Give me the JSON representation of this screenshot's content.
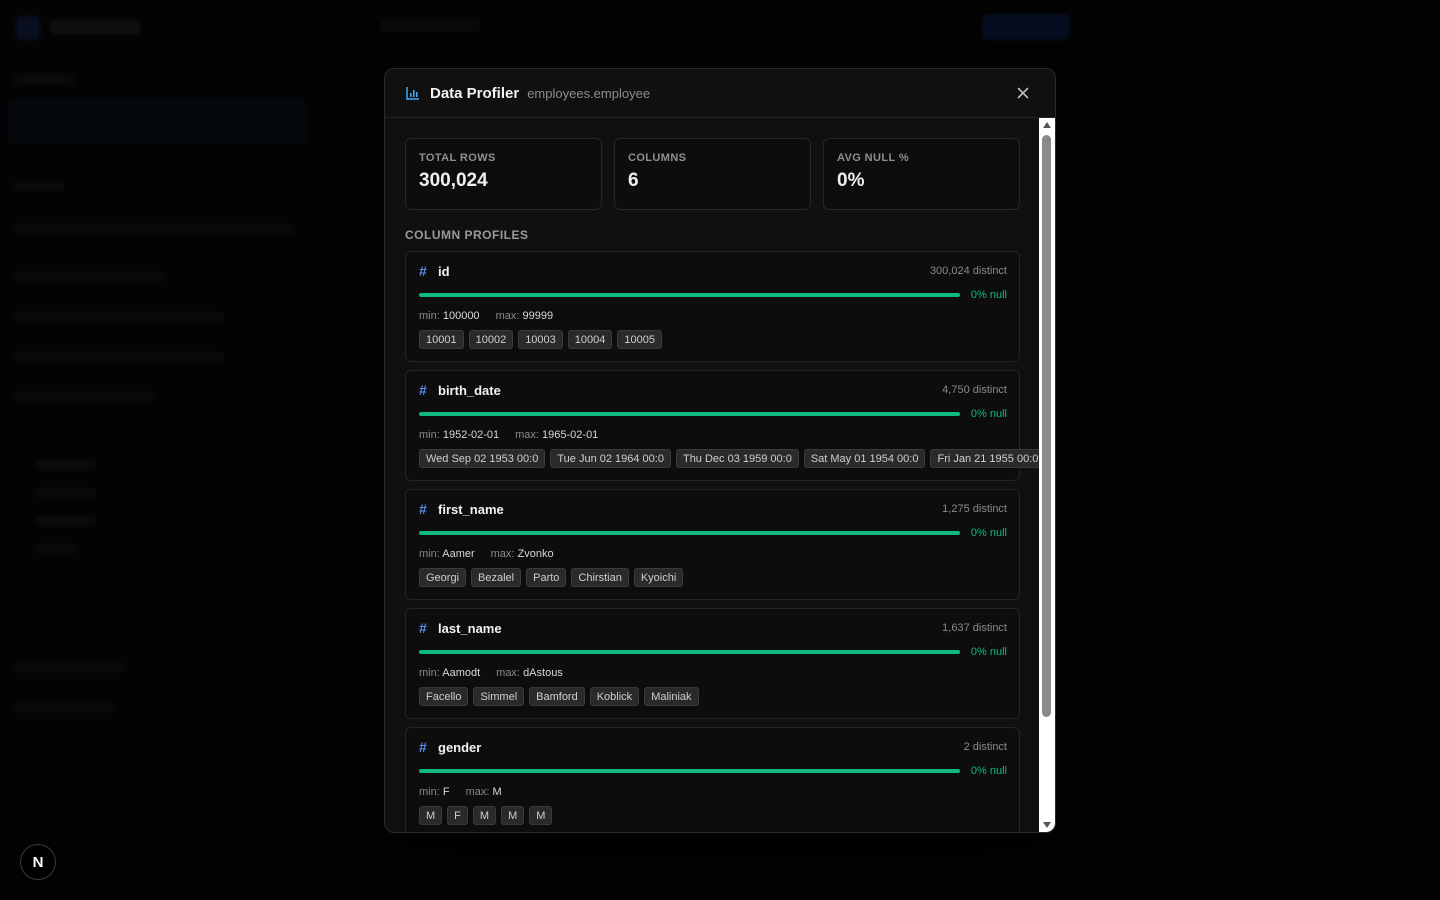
{
  "modal": {
    "title": "Data Profiler",
    "subtitle": "employees.employee"
  },
  "stats": [
    {
      "label": "TOTAL ROWS",
      "value": "300,024"
    },
    {
      "label": "COLUMNS",
      "value": "6"
    },
    {
      "label": "AVG NULL %",
      "value": "0%"
    }
  ],
  "section_title": "COLUMN PROFILES",
  "columns": [
    {
      "icon": "#",
      "name": "id",
      "distinct": "300,024 distinct",
      "null_text": "0% null",
      "min_label": "min:",
      "min": "100000",
      "max_label": "max:",
      "max": "99999",
      "samples": [
        "10001",
        "10002",
        "10003",
        "10004",
        "10005"
      ]
    },
    {
      "icon": "#",
      "name": "birth_date",
      "distinct": "4,750 distinct",
      "null_text": "0% null",
      "min_label": "min:",
      "min": "1952-02-01",
      "max_label": "max:",
      "max": "1965-02-01",
      "samples": [
        "Wed Sep 02 1953 00:0",
        "Tue Jun 02 1964 00:0",
        "Thu Dec 03 1959 00:0",
        "Sat May 01 1954 00:0",
        "Fri Jan 21 1955 00:0"
      ]
    },
    {
      "icon": "#",
      "name": "first_name",
      "distinct": "1,275 distinct",
      "null_text": "0% null",
      "min_label": "min:",
      "min": "Aamer",
      "max_label": "max:",
      "max": "Zvonko",
      "samples": [
        "Georgi",
        "Bezalel",
        "Parto",
        "Chirstian",
        "Kyoichi"
      ]
    },
    {
      "icon": "#",
      "name": "last_name",
      "distinct": "1,637 distinct",
      "null_text": "0% null",
      "min_label": "min:",
      "min": "Aamodt",
      "max_label": "max:",
      "max": "dAstous",
      "samples": [
        "Facello",
        "Simmel",
        "Bamford",
        "Koblick",
        "Maliniak"
      ]
    },
    {
      "icon": "#",
      "name": "gender",
      "distinct": "2 distinct",
      "null_text": "0% null",
      "min_label": "min:",
      "min": "F",
      "max_label": "max:",
      "max": "M",
      "samples": [
        "M",
        "F",
        "M",
        "M",
        "M"
      ]
    }
  ],
  "badge": {
    "letter": "N"
  },
  "colors": {
    "accent": "#10b981",
    "icon_blue": "#5b8def",
    "modal_bg": "#101010"
  }
}
